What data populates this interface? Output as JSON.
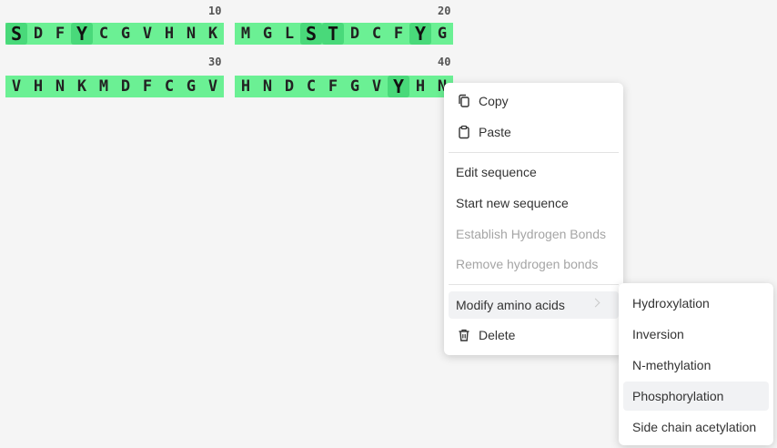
{
  "sequence": {
    "row1": {
      "chunks": [
        {
          "residues": [
            "S",
            "D",
            "F",
            "Y",
            "C",
            "G",
            "V",
            "H",
            "N",
            "K"
          ],
          "highlight": [
            0,
            3
          ]
        },
        {
          "residues": [
            "M",
            "G",
            "L",
            "S",
            "T",
            "D",
            "C",
            "F",
            "Y",
            "G"
          ],
          "highlight": [
            3,
            4,
            8
          ]
        }
      ],
      "counters": [
        "10",
        "20"
      ]
    },
    "row2": {
      "chunks": [
        {
          "residues": [
            "V",
            "H",
            "N",
            "K",
            "M",
            "D",
            "F",
            "C",
            "G",
            "V"
          ],
          "highlight": []
        },
        {
          "residues": [
            "H",
            "N",
            "D",
            "C",
            "F",
            "G",
            "V",
            "Y",
            "H",
            "N"
          ],
          "highlight": [
            7
          ]
        }
      ],
      "counters": [
        "30",
        "40"
      ]
    },
    "colors": {
      "fill": "#6bf094",
      "highlight": "#49d97a"
    }
  },
  "context_menu": {
    "copy": "Copy",
    "paste": "Paste",
    "edit_sequence": "Edit sequence",
    "start_new_sequence": "Start new sequence",
    "establish_hydrogen_bonds": "Establish Hydrogen Bonds",
    "remove_hydrogen_bonds": "Remove hydrogen bonds",
    "modify_amino_acids": "Modify amino acids",
    "delete": "Delete"
  },
  "submenu": {
    "items": [
      "Hydroxylation",
      "Inversion",
      "N-methylation",
      "Phosphorylation",
      "Side chain acetylation"
    ],
    "hovered": "Phosphorylation"
  }
}
